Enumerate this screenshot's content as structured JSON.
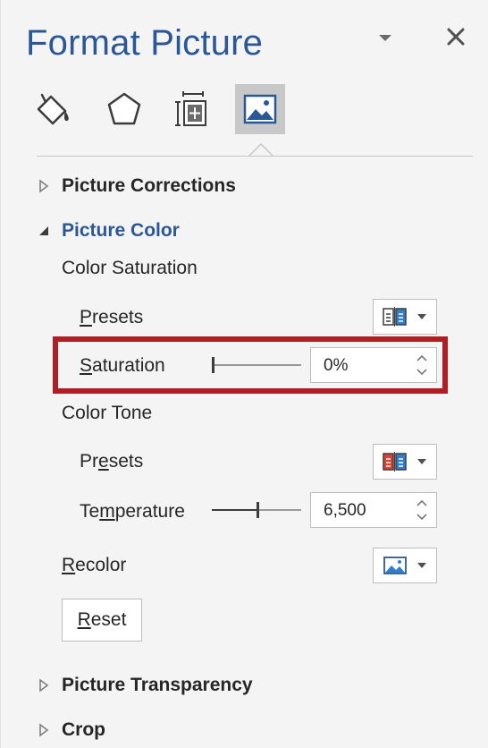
{
  "pane": {
    "title": "Format Picture",
    "tabs": [
      {
        "name": "fill-and-line",
        "icon": "paint-bucket-icon"
      },
      {
        "name": "effects",
        "icon": "pentagon-icon"
      },
      {
        "name": "size-and-properties",
        "icon": "size-properties-icon"
      },
      {
        "name": "picture",
        "icon": "picture-icon",
        "selected": true
      }
    ]
  },
  "sections": {
    "corrections": "Picture Corrections",
    "color": "Picture Color",
    "transparency": "Picture Transparency",
    "crop": "Crop"
  },
  "color_saturation": {
    "heading": "Color Saturation",
    "presets_label_u": "P",
    "presets_label_rest": "resets",
    "saturation_label_u": "S",
    "saturation_label_rest": "aturation",
    "saturation_value": "0%",
    "saturation_level_percent": 0
  },
  "color_tone": {
    "heading": "Color Tone",
    "presets_label_a": "Pr",
    "presets_label_u": "e",
    "presets_label_b": "sets",
    "temperature_label_a": "Te",
    "temperature_label_u": "m",
    "temperature_label_b": "perature",
    "temperature_value": "6,500"
  },
  "recolor": {
    "label_u": "R",
    "label_rest": "ecolor"
  },
  "reset": {
    "label_u": "R",
    "label_rest": "eset"
  },
  "colors": {
    "title": "#2b5797",
    "highlight_box": "#b01e24",
    "selected_tab": "#c8c8c8"
  }
}
